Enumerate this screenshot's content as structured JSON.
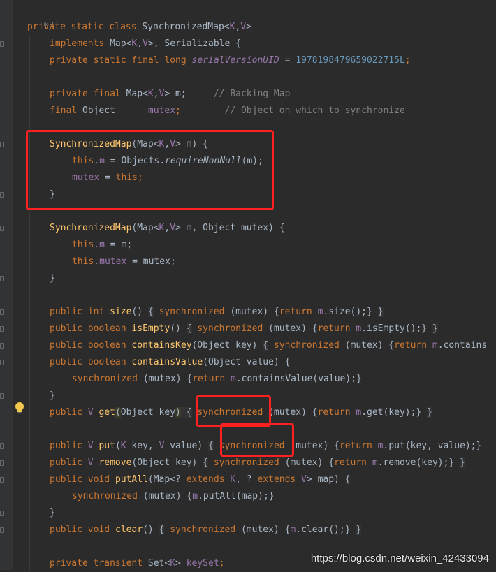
{
  "code": {
    "l0": "*/",
    "l1": [
      "private",
      "static",
      "class",
      "SynchronizedMap",
      "<",
      "K",
      ",",
      "V",
      ">"
    ],
    "l2": [
      "implements",
      "Map",
      "<",
      "K",
      ",",
      "V",
      ">",
      ", Serializable {"
    ],
    "l3": [
      "private",
      "static",
      "final",
      "long",
      "serialVersionUID",
      " = ",
      "1978198479659022715L",
      ";"
    ],
    "l5": [
      "private",
      "final",
      "Map",
      "<",
      "K",
      ",",
      "V",
      "> m;",
      "// Backing Map"
    ],
    "l6": [
      "final",
      "Object",
      "mutex",
      ";",
      "// Object on which to synchronize"
    ],
    "l8": [
      "SynchronizedMap",
      "(Map<",
      "K",
      ",",
      "V",
      "> m) {"
    ],
    "l9": [
      "this",
      ".m",
      " = Objects.",
      "requireNonNull",
      "(m);"
    ],
    "l10": [
      "mutex",
      " = ",
      "this",
      ";"
    ],
    "l11": "}",
    "l13": [
      "SynchronizedMap",
      "(Map<",
      "K",
      ",",
      "V",
      "> m, Object mutex) {"
    ],
    "l14": [
      "this",
      ".m",
      " = m;"
    ],
    "l15": [
      "this",
      ".mutex",
      " = mutex;"
    ],
    "l16": "}",
    "l18": [
      "public",
      "int",
      "size",
      "() ",
      "{",
      "synchronized",
      "(mutex) {",
      "return",
      "m",
      ".size();} ",
      "}"
    ],
    "l19": [
      "public",
      "boolean",
      "isEmpty",
      "() ",
      "{",
      "synchronized",
      "(mutex) {",
      "return",
      "m",
      ".isEmpty();} ",
      "}"
    ],
    "l20": [
      "public",
      "boolean",
      "containsKey",
      "(Object key) ",
      "{",
      "synchronized",
      "(mutex) {",
      "return",
      "m",
      ".contains"
    ],
    "l21": [
      "public",
      "boolean",
      "containsValue",
      "(Object value) {"
    ],
    "l22": [
      "synchronized",
      "(mutex) {",
      "return",
      "m",
      ".containsValue(value);}"
    ],
    "l23": "}",
    "l24": [
      "public",
      "V",
      "get",
      "(",
      "Object key",
      ")",
      " {",
      "synchronized",
      "(mutex) {",
      "return",
      "m",
      ".get(key);} ",
      "}"
    ],
    "l26": [
      "public",
      "V",
      "put",
      "(",
      "K",
      " key, ",
      "V",
      " value) ",
      "{",
      "synchronized",
      "(mutex) {",
      "return",
      "m",
      ".put(key, value);}"
    ],
    "l27": [
      "public",
      "V",
      "remove",
      "(Object key) ",
      "{",
      "synchronized",
      "(mutex) {",
      "return",
      "m",
      ".remove(key);} ",
      "}"
    ],
    "l28": [
      "public",
      "void",
      "putAll",
      "(Map<? ",
      "extends",
      "K",
      ", ? ",
      "extends",
      "V",
      "> map) {"
    ],
    "l29": [
      "synchronized",
      "(mutex) {",
      "m",
      ".putAll(map);}"
    ],
    "l30": "}",
    "l31": [
      "public",
      "void",
      "clear",
      "() ",
      "{",
      "synchronized",
      "(mutex) {",
      "m",
      ".clear();} ",
      "}"
    ],
    "l33": [
      "private",
      "transient",
      "Set",
      "<",
      "K",
      ">",
      "keySet",
      ";"
    ]
  },
  "watermark": "https://blog.csdn.net/weixin_42433094",
  "colors": {
    "background": "#2b2b2b",
    "keyword": "#cc7832",
    "type_param": "#9876aa",
    "method": "#ffc66d",
    "comment": "#808080",
    "number": "#6897bb",
    "annotation_box": "#ff2020"
  },
  "icons": [
    "lightbulb-icon",
    "fold-marker-icon"
  ]
}
